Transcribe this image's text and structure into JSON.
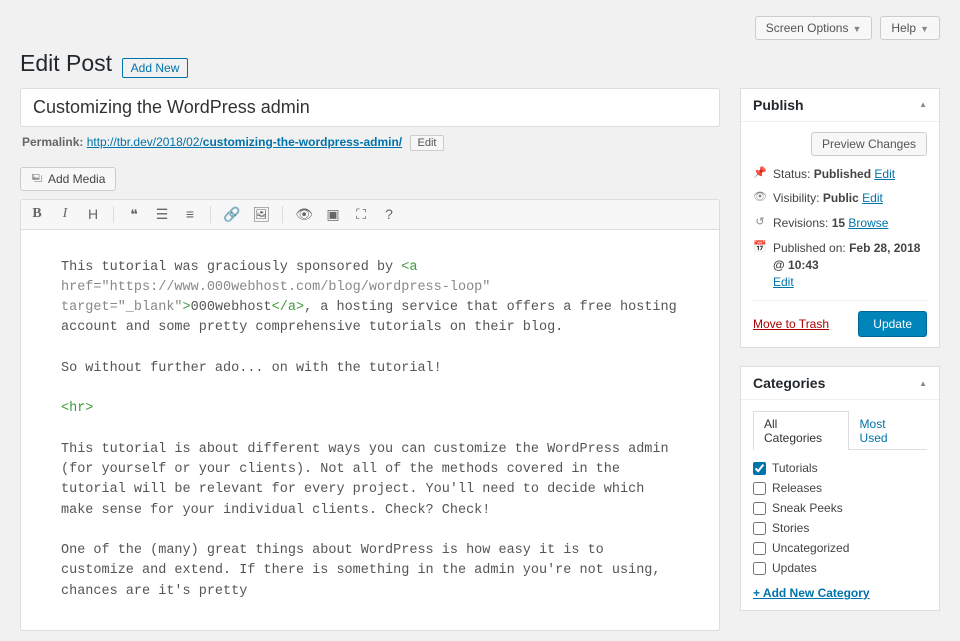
{
  "topbar": {
    "screen_options": "Screen Options",
    "help": "Help"
  },
  "title": "Edit Post",
  "addnew": "Add New",
  "post_title": "Customizing the WordPress admin",
  "permalink": {
    "label": "Permalink:",
    "base": "http://tbr.dev/2018/02/",
    "slug": "customizing-the-wordpress-admin/",
    "edit": "Edit"
  },
  "addmedia": "Add Media",
  "content": {
    "l1a": "This tutorial was graciously sponsored by ",
    "l1tag_open": "<a ",
    "l1attr": "href=\"https://www.000webhost.com/blog/wordpress-loop\" target=\"_blank\"",
    "l1tag_mid": ">",
    "l1text": "000webhost",
    "l1tag_close": "</a>",
    "l1b": ", a hosting service that offers a free hosting account and some pretty comprehensive tutorials on their blog.",
    "l2": "So without further ado... on with the tutorial!",
    "hr": "<hr>",
    "l3": "This tutorial is about different ways you can customize the WordPress admin (for yourself or your clients). Not all of the methods covered in the tutorial will be relevant for every project. You'll need to decide which make sense for your individual clients. Check? Check!",
    "l4": "One of the (many) great things about WordPress is how easy it is to customize and extend. If there is something in the admin you're not using, chances are it's pretty"
  },
  "publish": {
    "heading": "Publish",
    "preview": "Preview Changes",
    "status_label": "Status:",
    "status_value": "Published",
    "status_edit": "Edit",
    "vis_label": "Visibility:",
    "vis_value": "Public",
    "vis_edit": "Edit",
    "rev_label": "Revisions:",
    "rev_value": "15",
    "rev_browse": "Browse",
    "pub_label": "Published on:",
    "pub_value": "Feb 28, 2018 @ 10:43",
    "pub_edit": "Edit",
    "trash": "Move to Trash",
    "update": "Update"
  },
  "categories": {
    "heading": "Categories",
    "tab_all": "All Categories",
    "tab_most": "Most Used",
    "items": [
      {
        "label": "Tutorials",
        "checked": true
      },
      {
        "label": "Releases",
        "checked": false
      },
      {
        "label": "Sneak Peeks",
        "checked": false
      },
      {
        "label": "Stories",
        "checked": false
      },
      {
        "label": "Uncategorized",
        "checked": false
      },
      {
        "label": "Updates",
        "checked": false
      }
    ],
    "addnew": "+ Add New Category"
  }
}
